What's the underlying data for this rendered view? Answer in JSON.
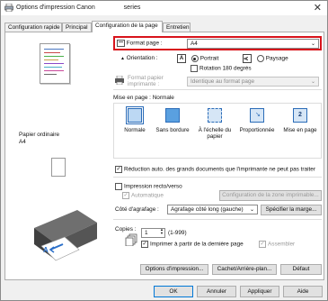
{
  "window": {
    "title": "Options d'impression Canon",
    "title_suffix": "series"
  },
  "tabs": [
    {
      "label": "Configuration rapide"
    },
    {
      "label": "Principal"
    },
    {
      "label": "Configuration de la page"
    },
    {
      "label": "Entretien"
    }
  ],
  "preview": {
    "paper_type": "Papier ordinaire",
    "paper_size": "A4"
  },
  "page_format": {
    "label": "Format page :",
    "value": "A4"
  },
  "orientation": {
    "label": "Orientation :",
    "portrait": "Portrait",
    "landscape": "Paysage",
    "rotate": "Rotation 180 degrés"
  },
  "printer_paper_size": {
    "label_line1": "Format papier",
    "label_line2": "imprimante :",
    "value": "Identique au format page"
  },
  "page_layout": {
    "label": "Mise en page : Normale",
    "options": [
      {
        "label": "Normale"
      },
      {
        "label": "Sans bordure"
      },
      {
        "label": "À l'échelle du papier"
      },
      {
        "label": "Proportionnée"
      },
      {
        "label": "Mise en page"
      }
    ],
    "auto_reduce": "Réduction auto. des grands documents que l'imprimante ne peut pas traiter"
  },
  "duplex": {
    "label": "Impression recto/verso",
    "automatic": "Automatique",
    "margin_button": "Configuration de la zone imprimable...",
    "stapling_label": "Côté d'agrafage :",
    "stapling_value": "Agrafage côté long (gauche)",
    "margin_spec_button": "Spécifier la marge..."
  },
  "copies": {
    "label": "Copies :",
    "value": "1",
    "range": "(1-999)",
    "last_page_first": "Imprimer à partir de la dernière page",
    "collate": "Assembler"
  },
  "panel_buttons": {
    "print_options": "Options d'impression...",
    "stamp_background": "Cachet/Arrière-plan...",
    "defaults": "Défaut"
  },
  "dialog_buttons": {
    "ok": "OK",
    "cancel": "Annuler",
    "apply": "Appliquer",
    "help": "Aide"
  }
}
